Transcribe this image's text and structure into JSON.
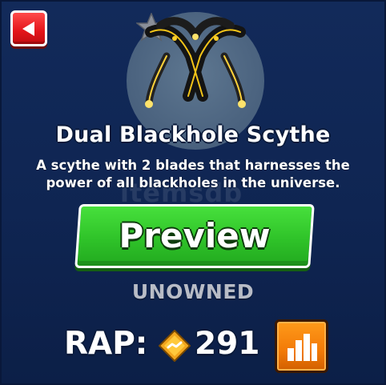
{
  "item": {
    "name": "Dual Blackhole Scythe",
    "description": "A scythe with 2 blades that harnesses the power of all blackholes in the universe.",
    "status": "UNOWNED",
    "rap_label": "RAP:",
    "rap_value": "291"
  },
  "buttons": {
    "preview_label": "Preview"
  },
  "watermark": "itemsdb",
  "icons": {
    "back": "back-arrow-icon",
    "favorite": "star-icon",
    "currency": "diamond-coin-icon",
    "stats": "bar-chart-icon"
  },
  "colors": {
    "background": "#122a5a",
    "back_button": "#e3141a",
    "preview_button": "#2fc329",
    "chart_button": "#f27a07",
    "status_text": "#b8bcc6"
  }
}
